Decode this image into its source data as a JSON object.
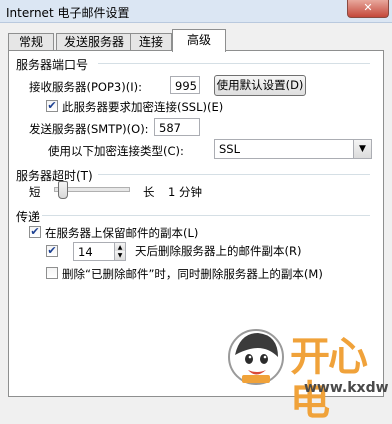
{
  "window": {
    "title": "Internet 电子邮件设置",
    "close_glyph": "✕"
  },
  "tabs": [
    {
      "label": "常规"
    },
    {
      "label": "发送服务器"
    },
    {
      "label": "连接"
    },
    {
      "label": "高级",
      "active": true
    }
  ],
  "ports": {
    "section_label": "服务器端口号",
    "incoming_label": "接收服务器(POP3)(I):",
    "incoming_value": "995",
    "default_button": "使用默认设置(D)",
    "ssl_checkbox_label": "此服务器要求加密连接(SSL)(E)",
    "ssl_checked": true,
    "outgoing_label": "发送服务器(SMTP)(O):",
    "outgoing_value": "587",
    "encryption_label": "使用以下加密连接类型(C):",
    "encryption_value": "SSL"
  },
  "timeout": {
    "section_label": "服务器超时(T)",
    "short_label": "短",
    "long_label": "长",
    "value_label": "1 分钟",
    "level": 0.06
  },
  "delivery": {
    "section_label": "传递",
    "keep_copy_label": "在服务器上保留邮件的副本(L)",
    "keep_copy_checked": true,
    "remove_after_checked": true,
    "days_value": "14",
    "remove_after_label": "天后删除服务器上的邮件副本(R)",
    "remove_deleted_label": "删除“已删除邮件”时，同时删除服务器上的副本(M)",
    "remove_deleted_checked": false
  },
  "watermark": {
    "text": "开心电",
    "url_fragment": "www.kxdw"
  },
  "colors": {
    "accent_check": "#1b3f91",
    "watermark_orange": "#f0a23a",
    "close_red": "#c4483a"
  }
}
